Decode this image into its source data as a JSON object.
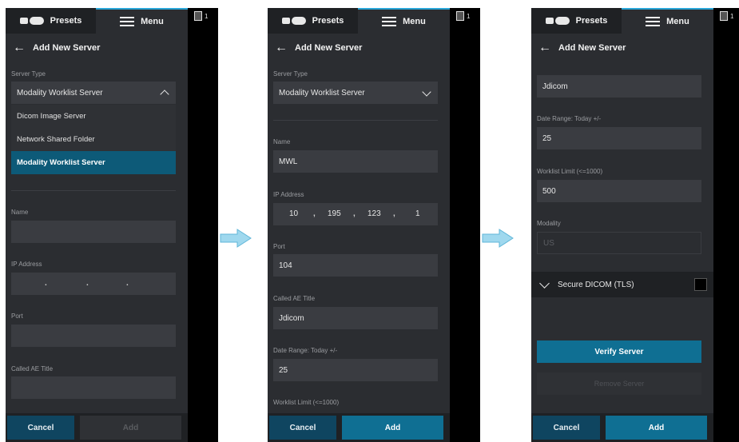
{
  "common": {
    "presets_label": "Presets",
    "menu_label": "Menu",
    "side_badge_count": "1",
    "title": "Add New Server",
    "cancel_label": "Cancel",
    "add_label": "Add"
  },
  "screen1": {
    "server_type_label": "Server Type",
    "server_type_value": "Modality Worklist Server",
    "dropdown_options": [
      "Dicom Image Server",
      "Network Shared Folder",
      "Modality Worklist Server"
    ],
    "selected_option": "Modality Worklist Server",
    "name_label": "Name",
    "ip_label": "IP Address",
    "port_label": "Port",
    "ae_title_label": "Called AE Title",
    "add_enabled": false
  },
  "screen2": {
    "server_type_label": "Server Type",
    "server_type_value": "Modality Worklist Server",
    "name_label": "Name",
    "name_value": "MWL",
    "ip_label": "IP Address",
    "ip_octets": [
      "10",
      "195",
      "123",
      "1"
    ],
    "port_label": "Port",
    "port_value": "104",
    "ae_title_label": "Called AE Title",
    "ae_title_value": "Jdicom",
    "date_range_label": "Date Range: Today +/-",
    "date_range_value": "25",
    "worklist_limit_label": "Worklist Limit (<=1000)",
    "add_enabled": true
  },
  "screen3": {
    "ae_title_value": "Jdicom",
    "date_range_label": "Date Range: Today +/-",
    "date_range_value": "25",
    "worklist_limit_label": "Worklist Limit (<=1000)",
    "worklist_limit_value": "500",
    "modality_label": "Modality",
    "modality_value": "US",
    "secure_dicom_label": "Secure DICOM (TLS)",
    "verify_label": "Verify Server",
    "remove_label": "Remove Server",
    "add_enabled": true
  },
  "colors": {
    "accent": "#0f6f93",
    "selected_option": "#0d5a78",
    "flow_arrow": "#9fd8ee"
  }
}
